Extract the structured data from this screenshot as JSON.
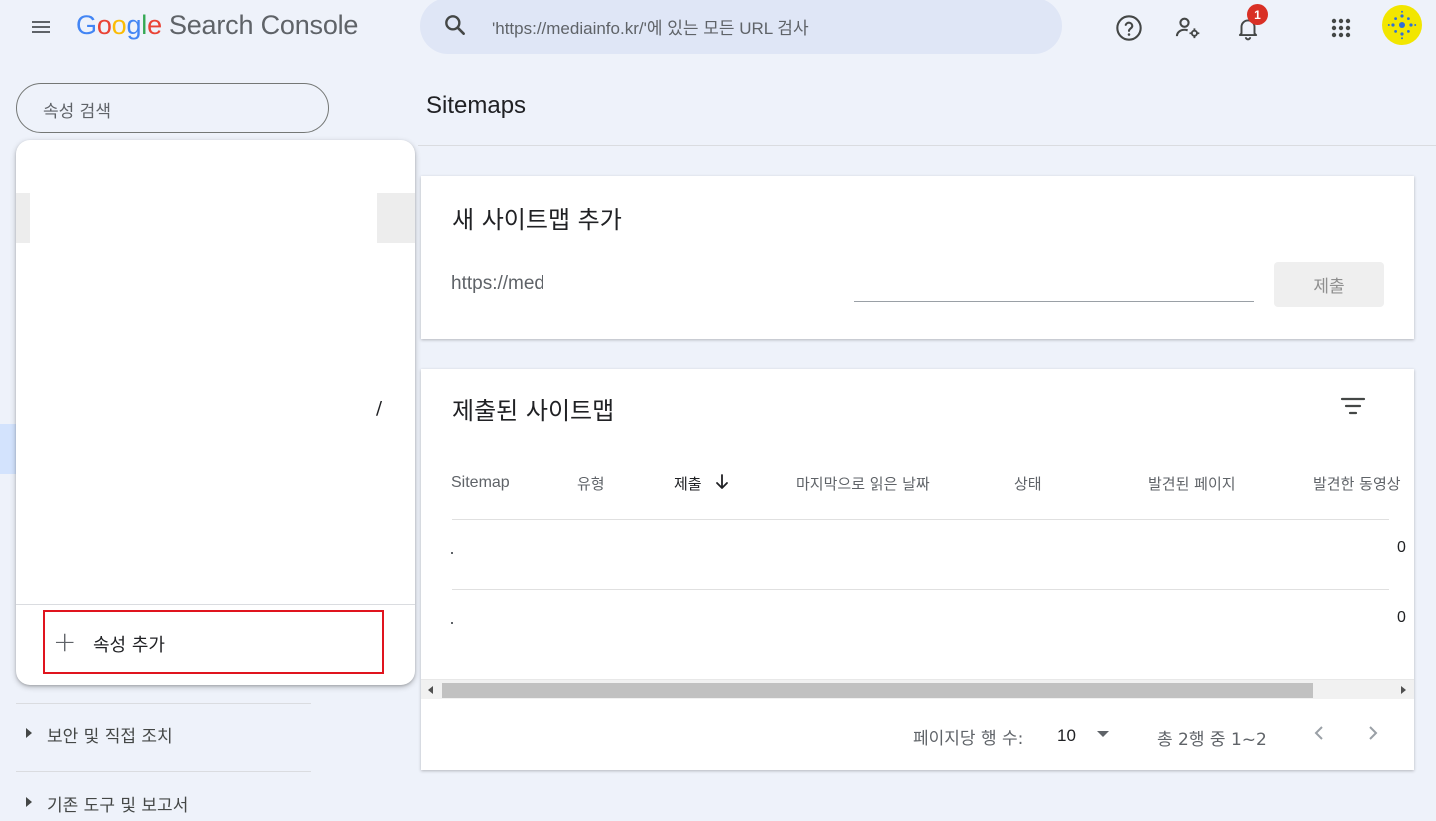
{
  "header": {
    "logo_letters": [
      "G",
      "o",
      "o",
      "g",
      "l",
      "e"
    ],
    "product_name": "Search Console",
    "search_text": "'https://mediainfo.kr/'에 있는 모든 URL 검사",
    "notification_count": "1"
  },
  "sidebar": {
    "property_search_placeholder": "속성 검색",
    "dropdown": {
      "partial_text": "/",
      "add_property_label": "속성 추가"
    },
    "nav_items": [
      {
        "label": "보안 및 직접 조치"
      },
      {
        "label": "기존 도구 및 보고서"
      }
    ]
  },
  "main": {
    "page_title": "Sitemaps",
    "add_sitemap": {
      "title": "새 사이트맵 추가",
      "url_prefix": "https://mediainfo.kr/",
      "submit_label": "제출"
    },
    "submitted_sitemaps": {
      "title": "제출된 사이트맵",
      "columns": [
        "Sitemap",
        "유형",
        "제출",
        "마지막으로 읽은 날짜",
        "상태",
        "발견된 페이지",
        "발견한 동영상"
      ],
      "sorted_column": "제출",
      "sort_direction": "descending",
      "rows": [
        {
          "videos_partial": "0"
        },
        {
          "videos_partial": "0"
        }
      ],
      "pagination": {
        "rows_per_page_label": "페이지당 행 수:",
        "rows_per_page": "10",
        "range_text": "총 2행 중 1~2"
      }
    }
  },
  "colors": {
    "background": "#eef2fa",
    "search_bg": "#dfe6f6",
    "badge": "#d93025",
    "highlight_border": "#e0141e",
    "avatar": "#f2e600"
  },
  "icons": [
    "menu-icon",
    "search-icon",
    "help-icon",
    "manage-users-icon",
    "notifications-icon",
    "apps-grid-icon",
    "filter-icon",
    "arrow-down-icon",
    "plus-icon",
    "chevron-left-icon",
    "chevron-right-icon"
  ]
}
